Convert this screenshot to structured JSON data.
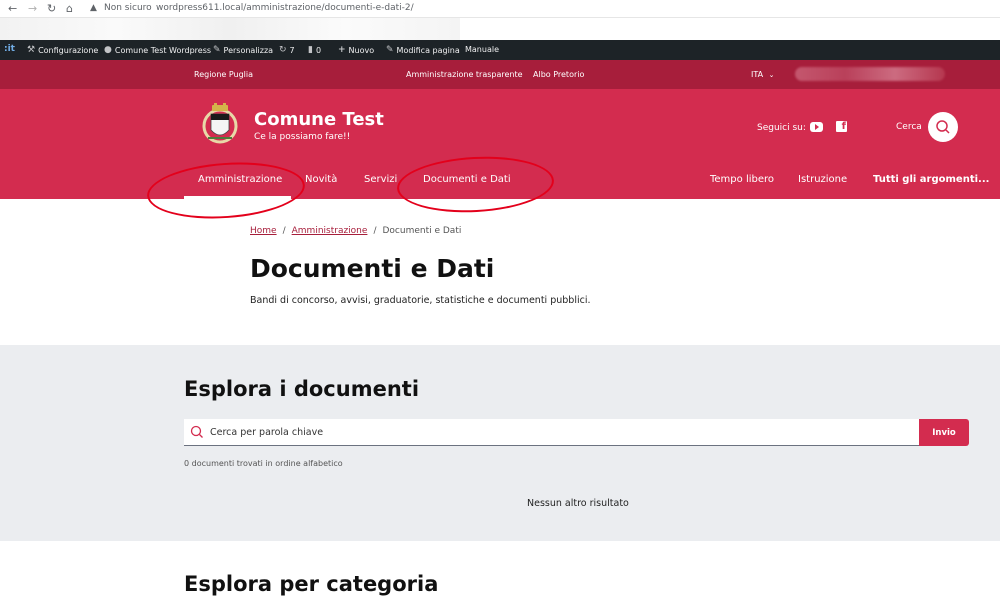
{
  "browser": {
    "security_label": "Non sicuro",
    "url": "wordpress611.local/amministrazione/documenti-e-dati-2/"
  },
  "admin_bar": {
    "logo": ":it",
    "items": [
      {
        "label": "Configurazione",
        "icon": "wrench-icon"
      },
      {
        "label": "Comune Test Wordpress",
        "icon": "dashboard-icon"
      },
      {
        "label": "Personalizza",
        "icon": "brush-icon"
      },
      {
        "label": "7",
        "icon": "updates-icon"
      },
      {
        "label": "0",
        "icon": "comment-icon"
      },
      {
        "label": "Nuovo",
        "icon": "plus-icon"
      },
      {
        "label": "Modifica pagina",
        "icon": "pencil-icon"
      },
      {
        "label": "Manuale",
        "icon": ""
      }
    ]
  },
  "top_strip": {
    "region": "Regione Puglia",
    "transparency": "Amministrazione trasparente",
    "registry": "Albo Pretorio",
    "language": "ITA"
  },
  "header": {
    "title": "Comune Test",
    "tagline": "Ce la possiamo fare!!",
    "follow_label": "Seguici su:",
    "search_label": "Cerca"
  },
  "nav": {
    "items": [
      "Amministrazione",
      "Novità",
      "Servizi",
      "Documenti e Dati"
    ],
    "right_items": [
      "Tempo libero",
      "Istruzione",
      "Tutti gli argomenti..."
    ]
  },
  "breadcrumb": {
    "home": "Home",
    "parent": "Amministrazione",
    "current": "Documenti e Dati",
    "separator": "/"
  },
  "page": {
    "title": "Documenti e Dati",
    "description": "Bandi di concorso, avvisi, graduatorie, statistiche e documenti pubblici."
  },
  "explore": {
    "title": "Esplora i documenti",
    "search_placeholder": "Cerca per parola chiave",
    "submit_label": "Invio",
    "results_count": "0 documenti trovati in ordine alfabetico",
    "no_results": "Nessun altro risultato"
  },
  "category": {
    "title": "Esplora per categoria"
  },
  "colors": {
    "brand_red": "#d32c4f",
    "dark_red": "#a71e3b",
    "annotation_red": "#e3001b"
  }
}
